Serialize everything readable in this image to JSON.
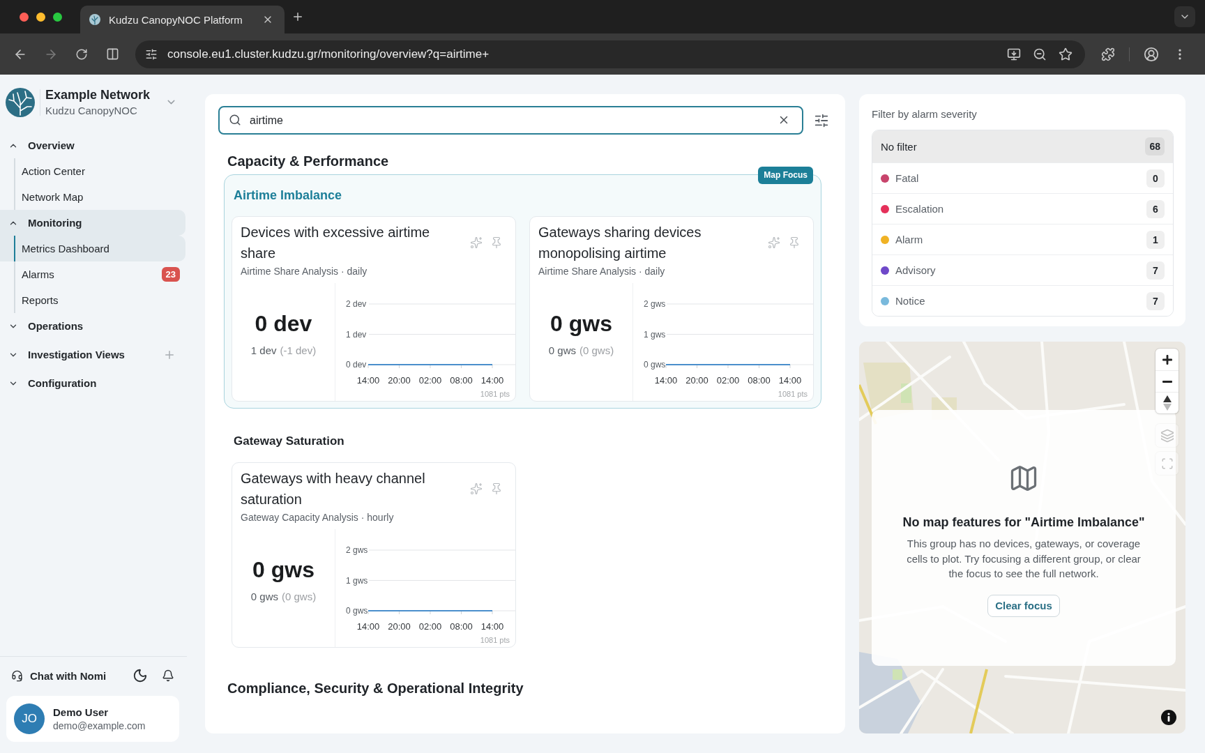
{
  "browser": {
    "tabs": [
      {
        "title": "Kudzu CanopyNOC Platform",
        "selected": true
      }
    ],
    "url": "console.eu1.cluster.kudzu.gr/monitoring/overview?q=airtime+"
  },
  "sidebar": {
    "org_name": "Example Network",
    "product": "Kudzu CanopyNOC",
    "nav": [
      {
        "label": "Overview",
        "expanded": true,
        "selected": false,
        "addable": false,
        "children": [
          {
            "label": "Action Center",
            "selected": false
          },
          {
            "label": "Network Map",
            "selected": false
          }
        ]
      },
      {
        "label": "Monitoring",
        "expanded": true,
        "selected": true,
        "addable": false,
        "children": [
          {
            "label": "Metrics Dashboard",
            "selected": true
          },
          {
            "label": "Alarms",
            "selected": false,
            "badge": "23"
          },
          {
            "label": "Reports",
            "selected": false
          }
        ]
      },
      {
        "label": "Operations",
        "expanded": false,
        "selected": false,
        "addable": false
      },
      {
        "label": "Investigation Views",
        "expanded": false,
        "selected": false,
        "addable": true
      },
      {
        "label": "Configuration",
        "expanded": false,
        "selected": false,
        "addable": false
      }
    ],
    "chat_label": "Chat with Nomi",
    "user": {
      "initials": "JO",
      "name": "Demo User",
      "email": "demo@example.com"
    }
  },
  "search": {
    "value": "airtime",
    "focused": true
  },
  "sections": [
    {
      "title": "Capacity & Performance",
      "groups": [
        {
          "title": "Airtime Imbalance",
          "focused": true,
          "focus_badge": "Map Focus",
          "cards": [
            {
              "title": "Devices with excessive airtime share",
              "subtitle": "Airtime Share Analysis · daily",
              "value": "0 dev",
              "previous": "1 dev",
              "change": "(-1 dev)",
              "points_label": "1081 pts",
              "chart_data": {
                "type": "line",
                "x": [
                  "14:00",
                  "20:00",
                  "02:00",
                  "08:00",
                  "14:00"
                ],
                "ylim": [
                  0,
                  2
                ],
                "yticks": [
                  {
                    "value": 0,
                    "label": "0 dev"
                  },
                  {
                    "value": 1,
                    "label": "1 dev"
                  },
                  {
                    "value": 2,
                    "label": "2 dev"
                  }
                ],
                "series": [
                  {
                    "color": "#4a8fcc",
                    "values": [
                      0,
                      0,
                      0,
                      0,
                      0
                    ]
                  }
                ]
              }
            },
            {
              "title": "Gateways sharing devices monopolising airtime",
              "subtitle": "Airtime Share Analysis · daily",
              "value": "0 gws",
              "previous": "0 gws",
              "change": "(0 gws)",
              "points_label": "1081 pts",
              "chart_data": {
                "type": "line",
                "x": [
                  "14:00",
                  "20:00",
                  "02:00",
                  "08:00",
                  "14:00"
                ],
                "ylim": [
                  0,
                  2
                ],
                "yticks": [
                  {
                    "value": 0,
                    "label": "0 gws"
                  },
                  {
                    "value": 1,
                    "label": "1 gws"
                  },
                  {
                    "value": 2,
                    "label": "2 gws"
                  }
                ],
                "series": [
                  {
                    "color": "#4a8fcc",
                    "values": [
                      0,
                      0,
                      0,
                      0,
                      0
                    ]
                  }
                ]
              }
            }
          ]
        },
        {
          "title": "Gateway Saturation",
          "focused": false,
          "cards": [
            {
              "title": "Gateways with heavy channel saturation",
              "subtitle": "Gateway Capacity Analysis · hourly",
              "value": "0 gws",
              "previous": "0 gws",
              "change": "(0 gws)",
              "points_label": "1081 pts",
              "chart_data": {
                "type": "line",
                "x": [
                  "14:00",
                  "20:00",
                  "02:00",
                  "08:00",
                  "14:00"
                ],
                "ylim": [
                  0,
                  2
                ],
                "yticks": [
                  {
                    "value": 0,
                    "label": "0 gws"
                  },
                  {
                    "value": 1,
                    "label": "1 gws"
                  },
                  {
                    "value": 2,
                    "label": "2 gws"
                  }
                ],
                "series": [
                  {
                    "color": "#4a8fcc",
                    "values": [
                      0,
                      0,
                      0,
                      0,
                      0
                    ]
                  }
                ]
              }
            }
          ]
        }
      ]
    },
    {
      "title": "Compliance, Security & Operational Integrity"
    }
  ],
  "alarm_filter": {
    "title": "Filter by alarm severity",
    "options": [
      {
        "label": "No filter",
        "count": "68",
        "selected": true
      },
      {
        "label": "Fatal",
        "count": "0",
        "color": "#c8446c",
        "selected": false
      },
      {
        "label": "Escalation",
        "count": "6",
        "color": "#e5305a",
        "selected": false
      },
      {
        "label": "Alarm",
        "count": "1",
        "color": "#f0b224",
        "selected": false
      },
      {
        "label": "Advisory",
        "count": "7",
        "color": "#6f48c9",
        "selected": false
      },
      {
        "label": "Notice",
        "count": "7",
        "color": "#79b9dc",
        "selected": false
      }
    ]
  },
  "map": {
    "empty_state": {
      "title": "No map features for \"Airtime Imbalance\"",
      "message": "This group has no devices, gateways, or coverage cells to plot. Try focusing a different group, or clear the focus to see the full network.",
      "button": "Clear focus"
    }
  }
}
